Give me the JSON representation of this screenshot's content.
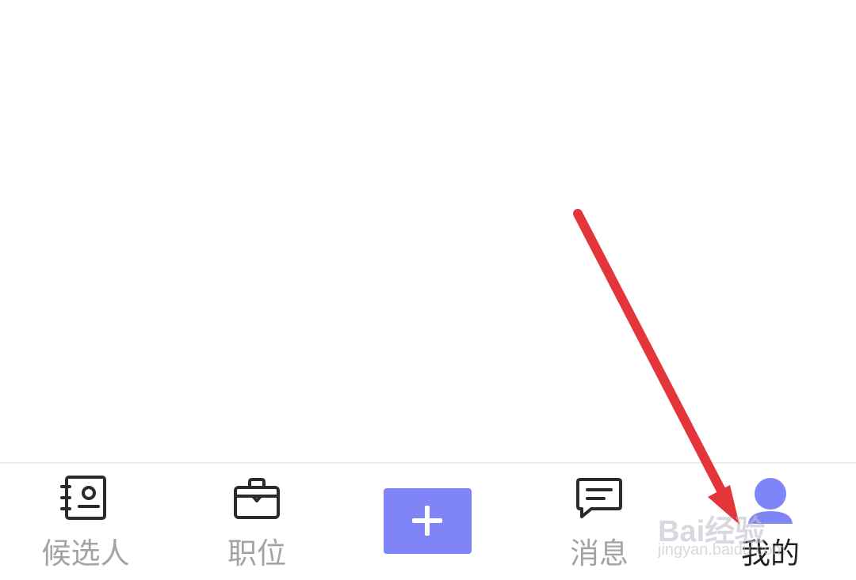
{
  "tabbar": {
    "items": [
      {
        "label": "候选人",
        "icon": "contacts-book-icon",
        "active": false
      },
      {
        "label": "职位",
        "icon": "briefcase-icon",
        "active": false
      },
      {
        "label": "",
        "icon": "plus-icon",
        "active": false
      },
      {
        "label": "消息",
        "icon": "chat-bubble-icon",
        "active": false
      },
      {
        "label": "我的",
        "icon": "person-icon",
        "active": true
      }
    ]
  },
  "watermark": {
    "brand": "Bai经验",
    "url": "jingyan.baidu.com"
  },
  "colors": {
    "accent": "#7f84f6",
    "inactive_label": "#a3a3a3",
    "active_label": "#222222",
    "icon_stroke": "#2b2b2b",
    "arrow": "#e3353a"
  }
}
